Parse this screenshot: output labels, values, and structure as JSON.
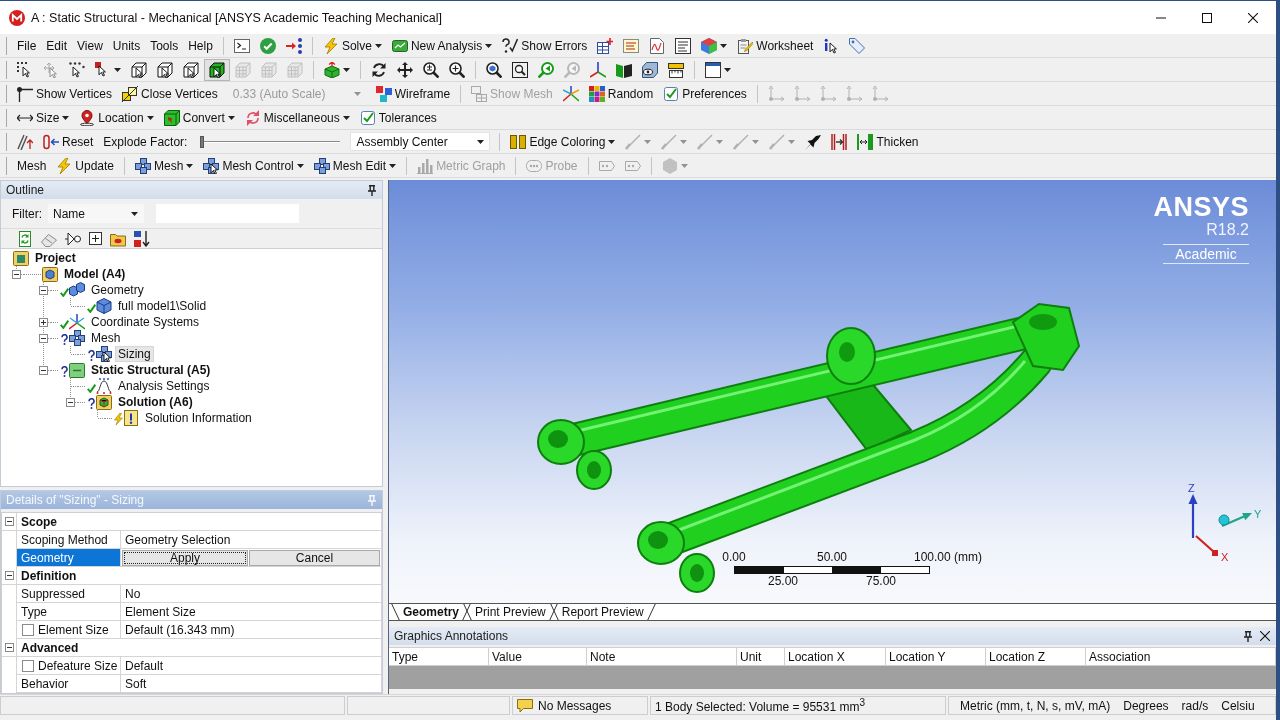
{
  "window": {
    "title": "A : Static Structural - Mechanical [ANSYS Academic Teaching Mechanical]"
  },
  "toolbars": [
    {
      "groups": [
        [
          {
            "kind": "menu",
            "label": "File"
          },
          {
            "kind": "menu",
            "label": "Edit"
          },
          {
            "kind": "menu",
            "label": "View"
          },
          {
            "kind": "menu",
            "label": "Units"
          },
          {
            "kind": "menu",
            "label": "Tools"
          },
          {
            "kind": "menu",
            "label": "Help"
          }
        ],
        [
          {
            "kind": "icon",
            "disabled": false
          },
          {
            "kind": "icon",
            "disabled": false
          },
          {
            "kind": "icon",
            "disabled": false
          }
        ],
        [
          {
            "kind": "button",
            "label": "Solve",
            "dropdown": true,
            "disabled": false
          },
          {
            "kind": "button",
            "label": "New Analysis",
            "dropdown": true,
            "disabled": false
          },
          {
            "kind": "button",
            "label": "Show Errors",
            "disabled": false
          },
          {
            "kind": "icon",
            "disabled": false
          },
          {
            "kind": "icon",
            "disabled": false
          },
          {
            "kind": "icon",
            "disabled": false
          },
          {
            "kind": "icon",
            "disabled": false
          },
          {
            "kind": "icon",
            "dropdown": true,
            "disabled": false
          },
          {
            "kind": "button",
            "label": "Worksheet",
            "disabled": false
          },
          {
            "kind": "icon",
            "disabled": false
          },
          {
            "kind": "icon",
            "disabled": false
          }
        ]
      ]
    },
    {
      "groups": [
        [
          {
            "kind": "icon",
            "disabled": false,
            "on": false
          },
          {
            "kind": "icon",
            "disabled": true,
            "on": false
          },
          {
            "kind": "icon",
            "disabled": false,
            "on": false
          },
          {
            "kind": "icon",
            "dropdown": true,
            "disabled": false,
            "on": false
          },
          {
            "kind": "icon",
            "disabled": false,
            "on": false
          },
          {
            "kind": "icon",
            "disabled": false,
            "on": false
          },
          {
            "kind": "icon",
            "disabled": false,
            "on": false
          },
          {
            "kind": "icon",
            "disabled": false,
            "on": true
          },
          {
            "kind": "icon",
            "disabled": true,
            "on": false
          },
          {
            "kind": "icon",
            "disabled": true,
            "on": false
          },
          {
            "kind": "icon",
            "disabled": true,
            "on": false
          }
        ],
        [
          {
            "kind": "icon",
            "dropdown": true,
            "disabled": false
          }
        ],
        [
          {
            "kind": "icon",
            "disabled": false
          },
          {
            "kind": "icon",
            "disabled": false
          },
          {
            "kind": "icon",
            "disabled": false
          },
          {
            "kind": "icon",
            "disabled": false
          }
        ],
        [
          {
            "kind": "icon",
            "disabled": false
          },
          {
            "kind": "icon",
            "disabled": false
          },
          {
            "kind": "icon",
            "disabled": false
          },
          {
            "kind": "icon",
            "disabled": true
          },
          {
            "kind": "icon",
            "disabled": false
          },
          {
            "kind": "icon",
            "disabled": false
          },
          {
            "kind": "icon",
            "disabled": false
          },
          {
            "kind": "icon",
            "disabled": false
          }
        ],
        [
          {
            "kind": "icon",
            "dropdown": true,
            "disabled": false
          }
        ]
      ]
    },
    {
      "groups": [
        [
          {
            "kind": "button",
            "label": "Show Vertices",
            "disabled": false
          },
          {
            "kind": "button",
            "label": "Close Vertices",
            "disabled": false
          },
          {
            "kind": "combo",
            "value": "0.33 (Auto Scale)",
            "disabled": true
          },
          {
            "kind": "button",
            "label": "Wireframe",
            "disabled": false
          }
        ],
        [
          {
            "kind": "button",
            "label": "Show Mesh",
            "disabled": true
          },
          {
            "kind": "icon",
            "disabled": false
          },
          {
            "kind": "button",
            "label": "Random",
            "disabled": false
          },
          {
            "kind": "button",
            "label": "Preferences",
            "disabled": false
          }
        ],
        [
          {
            "kind": "icon",
            "disabled": true
          },
          {
            "kind": "icon",
            "disabled": true
          },
          {
            "kind": "icon",
            "disabled": true
          },
          {
            "kind": "icon",
            "disabled": true
          },
          {
            "kind": "icon",
            "disabled": true
          }
        ]
      ]
    },
    {
      "groups": [
        [
          {
            "kind": "button",
            "label": "Size",
            "dropdown": true,
            "disabled": false
          },
          {
            "kind": "button",
            "label": "Location",
            "dropdown": true,
            "disabled": false
          },
          {
            "kind": "button",
            "label": "Convert",
            "dropdown": true,
            "disabled": false
          },
          {
            "kind": "button",
            "label": "Miscellaneous",
            "dropdown": true,
            "disabled": false
          },
          {
            "kind": "button",
            "label": "Tolerances",
            "disabled": false
          }
        ]
      ]
    },
    {
      "groups": [
        [
          {
            "kind": "icon",
            "disabled": false
          },
          {
            "kind": "button",
            "label": "Reset",
            "disabled": false
          },
          {
            "kind": "label",
            "label": "Explode Factor:"
          },
          {
            "kind": "slider",
            "level": 0
          },
          {
            "kind": "combo",
            "value": "Assembly Center",
            "disabled": false
          }
        ],
        [
          {
            "kind": "button",
            "label": "Edge Coloring",
            "dropdown": true,
            "disabled": false
          },
          {
            "kind": "icon",
            "dropdown": true,
            "disabled": true
          },
          {
            "kind": "icon",
            "dropdown": true,
            "disabled": true
          },
          {
            "kind": "icon",
            "dropdown": true,
            "disabled": true
          },
          {
            "kind": "icon",
            "dropdown": true,
            "disabled": true
          },
          {
            "kind": "icon",
            "dropdown": true,
            "disabled": true
          },
          {
            "kind": "icon",
            "disabled": false
          },
          {
            "kind": "icon",
            "disabled": false
          },
          {
            "kind": "button",
            "label": "Thicken",
            "disabled": false
          }
        ]
      ]
    },
    {
      "groups": [
        [
          {
            "kind": "label",
            "label": "Mesh"
          },
          {
            "kind": "button",
            "label": "Update",
            "disabled": false
          }
        ],
        [
          {
            "kind": "button",
            "label": "Mesh",
            "dropdown": true,
            "disabled": false
          },
          {
            "kind": "button",
            "label": "Mesh Control",
            "dropdown": true,
            "disabled": false
          },
          {
            "kind": "button",
            "label": "Mesh Edit",
            "dropdown": true,
            "disabled": false
          }
        ],
        [
          {
            "kind": "button",
            "label": "Metric Graph",
            "disabled": true
          }
        ],
        [
          {
            "kind": "button",
            "label": "Probe",
            "disabled": true
          }
        ],
        [
          {
            "kind": "icon",
            "disabled": true
          },
          {
            "kind": "icon",
            "disabled": true
          }
        ],
        [
          {
            "kind": "icon",
            "dropdown": true,
            "disabled": true
          }
        ]
      ]
    }
  ],
  "outline": {
    "title": "Outline",
    "filter": {
      "label": "Filter:",
      "value": "Name"
    },
    "tools": [
      {
        "disabled": false
      },
      {
        "disabled": false
      },
      {
        "disabled": false
      },
      {
        "disabled": false
      },
      {
        "disabled": false
      },
      {
        "disabled": false
      }
    ],
    "tree": [
      {
        "label": "Project",
        "kind": "project",
        "bold": true,
        "selected": false,
        "children": [
          {
            "label": "Model (A4)",
            "kind": "model",
            "bold": true,
            "expanded": true,
            "selected": false,
            "children": [
              {
                "label": "Geometry",
                "kind": "geometry",
                "bold": false,
                "defined": true,
                "outdated": false,
                "expanded": true,
                "selected": false,
                "children": [
                  {
                    "label": "full model1\\Solid",
                    "kind": "body",
                    "bold": false,
                    "defined": true,
                    "outdated": false,
                    "selected": false
                  }
                ]
              },
              {
                "label": "Coordinate Systems",
                "kind": "axes",
                "bold": false,
                "defined": true,
                "outdated": false,
                "expanded": false,
                "selected": false
              },
              {
                "label": "Mesh",
                "kind": "mesh",
                "bold": false,
                "defined": false,
                "outdated": false,
                "expanded": true,
                "selected": false,
                "children": [
                  {
                    "label": "Sizing",
                    "kind": "sizing",
                    "bold": false,
                    "defined": false,
                    "outdated": false,
                    "selected": true
                  }
                ]
              },
              {
                "label": "Static Structural (A5)",
                "kind": "analysis",
                "bold": true,
                "defined": false,
                "outdated": false,
                "expanded": true,
                "selected": false,
                "children": [
                  {
                    "label": "Analysis Settings",
                    "kind": "settings",
                    "bold": false,
                    "defined": true,
                    "outdated": false,
                    "selected": false
                  },
                  {
                    "label": "Solution (A6)",
                    "kind": "solution",
                    "bold": true,
                    "defined": false,
                    "outdated": false,
                    "expanded": true,
                    "selected": false,
                    "children": [
                      {
                        "label": "Solution Information",
                        "kind": "info",
                        "bold": false,
                        "defined": true,
                        "outdated": true,
                        "selected": false
                      }
                    ]
                  }
                ]
              }
            ]
          }
        ]
      }
    ]
  },
  "details": {
    "title": "Details of \"Sizing\" - Sizing",
    "groups": [
      {
        "label": "Scope",
        "expanded": true,
        "rows": [
          {
            "kind": "text",
            "label": "Scoping Method",
            "value": "Geometry Selection",
            "selected": false
          },
          {
            "kind": "buttons",
            "label": "Geometry",
            "buttons": [
              {
                "label": "Apply",
                "focused": true
              },
              {
                "label": "Cancel",
                "focused": false
              }
            ],
            "selected": true
          }
        ]
      },
      {
        "label": "Definition",
        "expanded": true,
        "rows": [
          {
            "kind": "text",
            "label": "Suppressed",
            "value": "No",
            "selected": false
          },
          {
            "kind": "text",
            "label": "Type",
            "value": "Element Size",
            "selected": false
          },
          {
            "kind": "text",
            "label": "Element Size",
            "value": "Default (16.343 mm)",
            "checked": false,
            "selected": false
          }
        ]
      },
      {
        "label": "Advanced",
        "expanded": true,
        "rows": [
          {
            "kind": "text",
            "label": "Defeature Size",
            "value": "Default",
            "checked": false,
            "selected": false
          },
          {
            "kind": "text",
            "label": "Behavior",
            "value": "Soft",
            "selected": false
          }
        ]
      }
    ]
  },
  "viewport": {
    "logo": {
      "brand": "ANSYS",
      "version": "R18.2",
      "edition": "Academic"
    },
    "scale_bar": {
      "top_labels": [
        "0.00",
        "50.00",
        "100.00 (mm)"
      ],
      "bottom_labels": [
        "25.00",
        "75.00"
      ]
    },
    "triad": [
      {
        "label": "Z",
        "color": "#2a3fc4"
      },
      {
        "label": "Y",
        "color": "#1fa58a"
      },
      {
        "label": "X",
        "color": "#cc2222"
      }
    ]
  },
  "view_tabs": [
    {
      "label": "Geometry",
      "selected": true
    },
    {
      "label": "Print Preview",
      "selected": false
    },
    {
      "label": "Report Preview",
      "selected": false
    }
  ],
  "annotations": {
    "title": "Graphics Annotations",
    "columns": [
      "Type",
      "Value",
      "Note",
      "Unit",
      "Location X",
      "Location Y",
      "Location Z",
      "Association"
    ]
  },
  "status_bar": {
    "message": "No Messages",
    "selection": "1 Body Selected: Volume = 95531 mm$^{3}$",
    "units": [
      "Metric (mm, t, N, s, mV, mA)",
      "Degrees",
      "rad/s",
      "Celsiu"
    ]
  }
}
